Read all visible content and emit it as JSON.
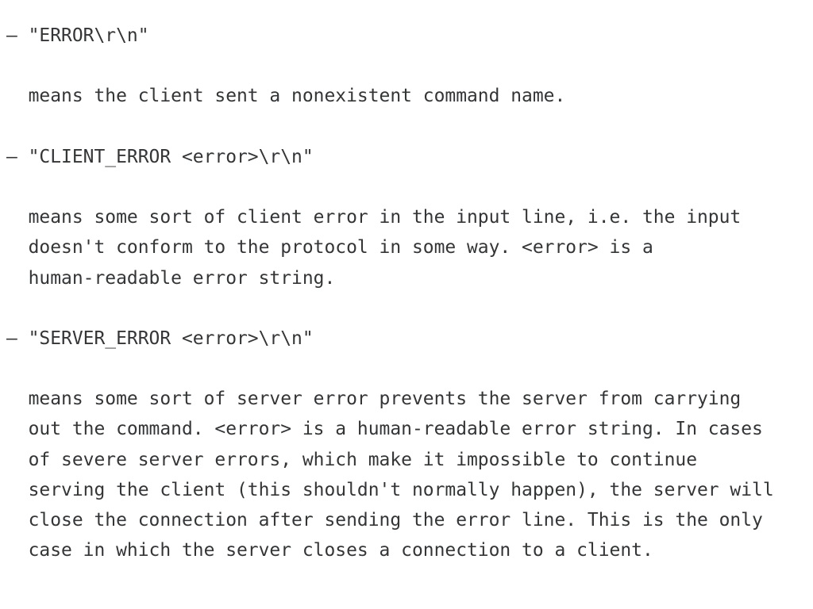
{
  "document": {
    "kind": "plain-text-protocol-spec",
    "background_color": "#ffffff",
    "text_color": "#333537",
    "bullet_marker": "–",
    "blocks": [
      {
        "id": "error",
        "heading": "– \"ERROR\\r\\n\"",
        "paragraph_lines": [
          "  means the client sent a nonexistent command name."
        ]
      },
      {
        "id": "client-error",
        "heading": "– \"CLIENT_ERROR <error>\\r\\n\"",
        "paragraph_lines": [
          "  means some sort of client error in the input line, i.e. the input",
          "  doesn't conform to the protocol in some way. <error> is a",
          "  human-readable error string."
        ]
      },
      {
        "id": "server-error",
        "heading": "– \"SERVER_ERROR <error>\\r\\n\"",
        "paragraph_lines": [
          "  means some sort of server error prevents the server from carrying",
          "  out the command. <error> is a human-readable error string. In cases",
          "  of severe server errors, which make it impossible to continue",
          "  serving the client (this shouldn't normally happen), the server will",
          "  close the connection after sending the error line. This is the only",
          "  case in which the server closes a connection to a client."
        ]
      }
    ],
    "lines": [
      "– \"ERROR\\r\\n\"",
      "",
      "  means the client sent a nonexistent command name.",
      "",
      "– \"CLIENT_ERROR <error>\\r\\n\"",
      "",
      "  means some sort of client error in the input line, i.e. the input",
      "  doesn't conform to the protocol in some way. <error> is a",
      "  human-readable error string.",
      "",
      "– \"SERVER_ERROR <error>\\r\\n\"",
      "",
      "  means some sort of server error prevents the server from carrying",
      "  out the command. <error> is a human-readable error string. In cases",
      "  of severe server errors, which make it impossible to continue",
      "  serving the client (this shouldn't normally happen), the server will",
      "  close the connection after sending the error line. This is the only",
      "  case in which the server closes a connection to a client."
    ]
  }
}
